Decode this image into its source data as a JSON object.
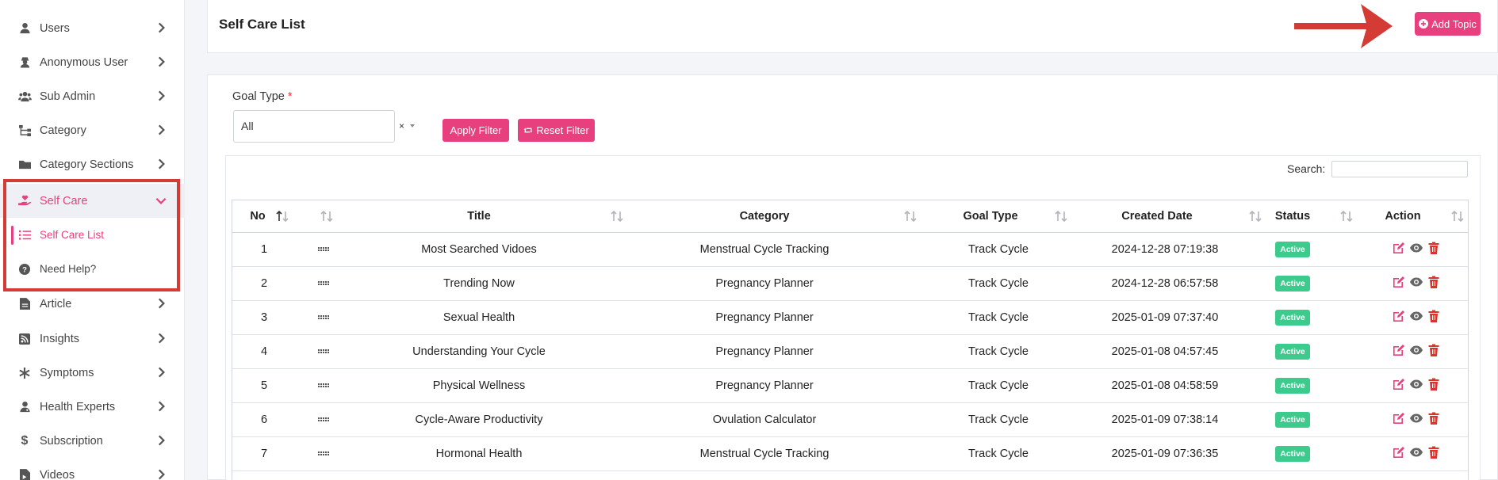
{
  "sidebar": {
    "items": [
      {
        "label": "Users",
        "icon": "user-icon"
      },
      {
        "label": "Anonymous User",
        "icon": "user-secret-icon"
      },
      {
        "label": "Sub Admin",
        "icon": "users-icon"
      },
      {
        "label": "Category",
        "icon": "sitemap-icon"
      },
      {
        "label": "Category Sections",
        "icon": "folder-icon"
      },
      {
        "label": "Self Care",
        "icon": "hand-holding-heart-icon"
      },
      {
        "label": "Self Care List",
        "icon": "list-icon"
      },
      {
        "label": "Need Help?",
        "icon": "question-circle-icon"
      },
      {
        "label": "Article",
        "icon": "file-icon"
      },
      {
        "label": "Insights",
        "icon": "rss-icon"
      },
      {
        "label": "Symptoms",
        "icon": "asterisk-icon"
      },
      {
        "label": "Health Experts",
        "icon": "user-md-icon"
      },
      {
        "label": "Subscription",
        "icon": "dollar-icon"
      },
      {
        "label": "Videos",
        "icon": "file-video-icon"
      }
    ]
  },
  "header": {
    "title": "Self Care List",
    "add_button": "Add Topic"
  },
  "filter": {
    "goal_type_label": "Goal Type",
    "required_mark": "*",
    "goal_type_value": "All",
    "clear": "×",
    "apply_button": "Apply Filter",
    "reset_button": "Reset Filter"
  },
  "search": {
    "label": "Search:",
    "value": ""
  },
  "table": {
    "columns": [
      "No",
      "Title",
      "Category",
      "Goal Type",
      "Created Date",
      "Status",
      "Action"
    ],
    "rows": [
      {
        "no": "1",
        "title": "Most Searched Vidoes",
        "category": "Menstrual Cycle Tracking",
        "goal": "Track Cycle",
        "date": "2024-12-28 07:19:38",
        "status": "Active"
      },
      {
        "no": "2",
        "title": "Trending Now",
        "category": "Pregnancy Planner",
        "goal": "Track Cycle",
        "date": "2024-12-28 06:57:58",
        "status": "Active"
      },
      {
        "no": "3",
        "title": "Sexual Health",
        "category": "Pregnancy Planner",
        "goal": "Track Cycle",
        "date": "2025-01-09 07:37:40",
        "status": "Active"
      },
      {
        "no": "4",
        "title": "Understanding Your Cycle",
        "category": "Pregnancy Planner",
        "goal": "Track Cycle",
        "date": "2025-01-08 04:57:45",
        "status": "Active"
      },
      {
        "no": "5",
        "title": "Physical Wellness",
        "category": "Pregnancy Planner",
        "goal": "Track Cycle",
        "date": "2025-01-08 04:58:59",
        "status": "Active"
      },
      {
        "no": "6",
        "title": "Cycle-Aware Productivity",
        "category": "Ovulation Calculator",
        "goal": "Track Cycle",
        "date": "2025-01-09 07:38:14",
        "status": "Active"
      },
      {
        "no": "7",
        "title": "Hormonal Health",
        "category": "Menstrual Cycle Tracking",
        "goal": "Track Cycle",
        "date": "2025-01-09 07:36:35",
        "status": "Active"
      }
    ]
  },
  "colors": {
    "accent": "#e8407e",
    "active_badge": "#3ccb8c",
    "edit": "#e8407e",
    "delete": "#d9342b",
    "highlight": "#d43b34"
  }
}
